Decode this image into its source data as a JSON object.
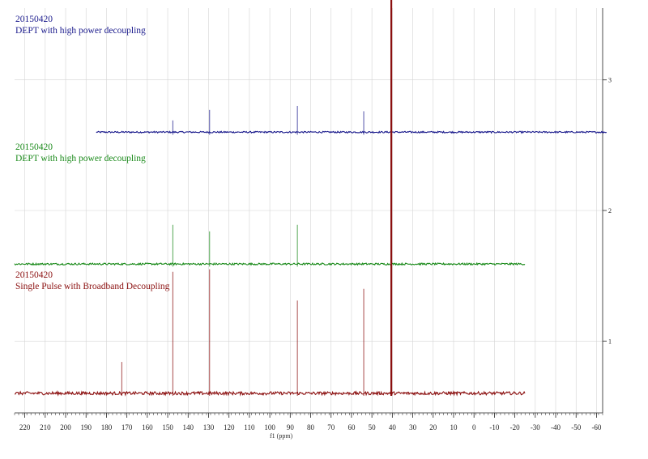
{
  "chart_data": {
    "type": "line",
    "title": "",
    "xlabel": "f1 (ppm)",
    "xlim": [
      225,
      -63
    ],
    "x_ticks": [
      220,
      210,
      200,
      190,
      180,
      170,
      160,
      150,
      140,
      130,
      120,
      110,
      100,
      90,
      80,
      70,
      60,
      50,
      40,
      30,
      20,
      10,
      0,
      -10,
      -20,
      -30,
      -40,
      -50,
      -60
    ],
    "ylim": [
      0.45,
      3.55
    ],
    "y_ticks": [
      1,
      2,
      3
    ],
    "grid": true,
    "series": [
      {
        "label_line1": "20150420",
        "label_line2": "DEPT with high power decoupling",
        "color": "#1a1a8c",
        "baseline": 2.6,
        "x_range": [
          185,
          -65
        ],
        "noise": 0.006,
        "peaks": [
          {
            "x": 147.5,
            "height": 0.09
          },
          {
            "x": 129.5,
            "height": 0.17
          },
          {
            "x": 86.5,
            "height": 0.2
          },
          {
            "x": 54.0,
            "height": 0.16
          },
          {
            "x": 40.5,
            "height": 0.05
          }
        ]
      },
      {
        "label_line1": "20150420",
        "label_line2": "DEPT with high power decoupling",
        "color": "#1a8a1a",
        "baseline": 1.59,
        "x_range": [
          225,
          -25
        ],
        "noise": 0.007,
        "peaks": [
          {
            "x": 147.5,
            "height": 0.3
          },
          {
            "x": 129.5,
            "height": 0.25
          },
          {
            "x": 86.5,
            "height": 0.3
          },
          {
            "x": 40.5,
            "height": 0.8
          }
        ]
      },
      {
        "label_line1": "20150420",
        "label_line2": "Single Pulse with Broadband Decoupling",
        "color": "#8b0f0f",
        "baseline": 0.6,
        "x_range": [
          225,
          -25
        ],
        "noise": 0.012,
        "peaks": [
          {
            "x": 172.5,
            "height": 0.24
          },
          {
            "x": 147.5,
            "height": 0.93
          },
          {
            "x": 129.5,
            "height": 0.95
          },
          {
            "x": 86.5,
            "height": 0.71
          },
          {
            "x": 54.0,
            "height": 0.8
          },
          {
            "x": 40.5,
            "height": 3.02
          }
        ]
      }
    ]
  }
}
